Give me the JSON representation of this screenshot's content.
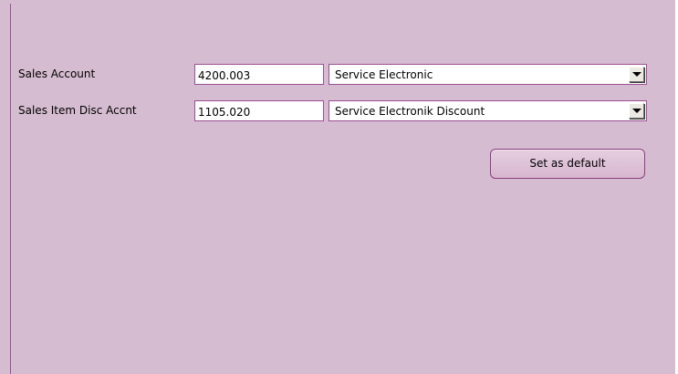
{
  "form": {
    "sales_account": {
      "label": "Sales Account",
      "code": "4200.003",
      "selected": "Service Electronic"
    },
    "sales_item_disc_account": {
      "label": "Sales Item Disc Accnt",
      "code": "1105.020",
      "selected": "Service Electronik Discount"
    },
    "set_default_label": "Set as default"
  },
  "colors": {
    "panel_background": "#d6bcd0",
    "accent_border": "#9b4f96"
  },
  "icons": {
    "dropdown": "chevron-down-icon"
  }
}
